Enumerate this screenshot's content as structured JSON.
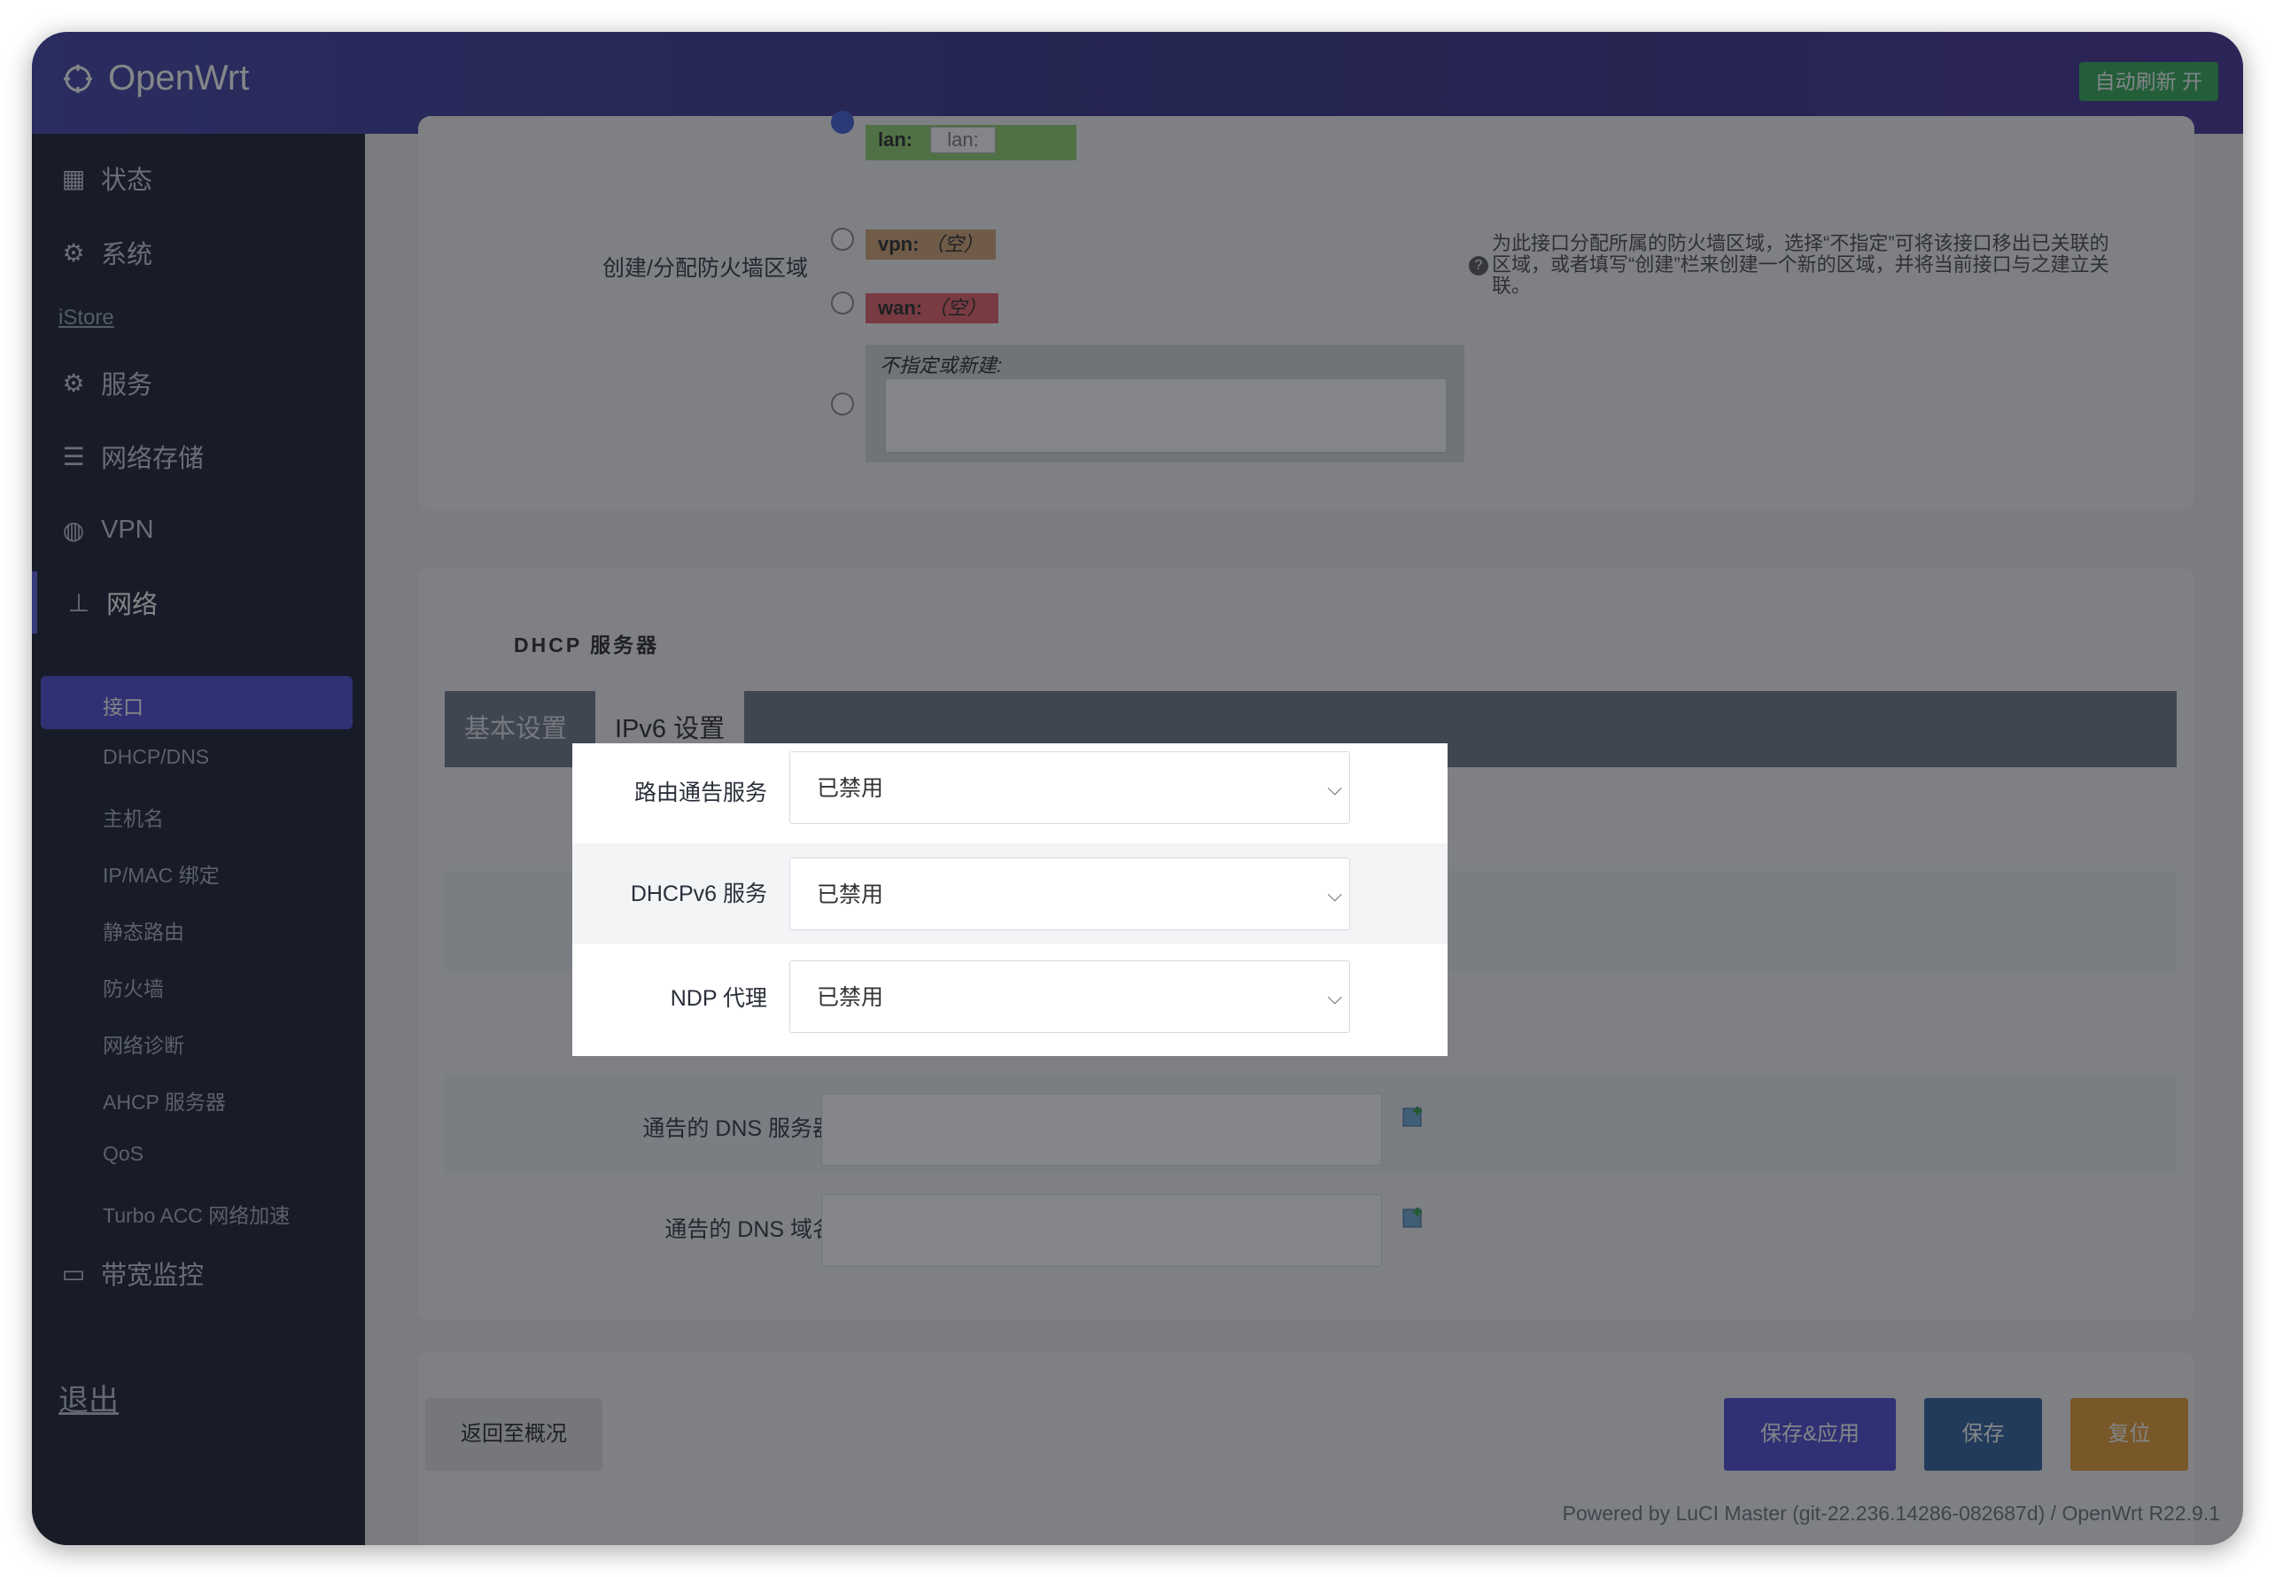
{
  "app": {
    "title": "OpenWrt",
    "autorefresh": "自动刷新 开"
  },
  "sidebar": {
    "items": [
      {
        "label": "状态",
        "icon": "dashboard-icon"
      },
      {
        "label": "系统",
        "icon": "gear-icon"
      },
      {
        "label": "服务",
        "icon": "gears-icon"
      },
      {
        "label": "网络存储",
        "icon": "database-icon"
      },
      {
        "label": "VPN",
        "icon": "globe-icon"
      },
      {
        "label": "网络",
        "icon": "sitemap-icon"
      },
      {
        "label": "带宽监控",
        "icon": "monitor-icon"
      }
    ],
    "istore": "iStore",
    "network_sub": [
      "接口",
      "DHCP/DNS",
      "主机名",
      "IP/MAC 绑定",
      "静态路由",
      "防火墙",
      "网络诊断",
      "AHCP 服务器",
      "QoS",
      "Turbo ACC 网络加速"
    ],
    "logout": "退出"
  },
  "firewall": {
    "label": "创建/分配防火墙区域",
    "lan_tag": "lan:",
    "lan_sub": "lan:",
    "vpn_tag": "vpn:",
    "wan_tag": "wan:",
    "empty": "（空）",
    "custom_label": "不指定或新建:",
    "help": [
      "为此接口分配所属的防火墙区域，选择“不指定”可将该接口移出已关联的",
      "区域，或者填写“创建”栏来创建一个新的区域，并将当前接口与之建立关",
      "联。"
    ]
  },
  "dhcp": {
    "section_title": "DHCP 服务器",
    "tabs": [
      "基本设置",
      "IPv6 设置"
    ],
    "fields": [
      {
        "label": "路由通告服务",
        "value": "已禁用"
      },
      {
        "label": "DHCPv6 服务",
        "value": "已禁用"
      },
      {
        "label": "NDP 代理",
        "value": "已禁用"
      }
    ],
    "dns_server_label": "通告的 DNS 服务器",
    "dns_domain_label": "通告的 DNS 域名"
  },
  "actions": {
    "back": "返回至概况",
    "save_apply": "保存&应用",
    "save": "保存",
    "reset": "复位"
  },
  "footer": "Powered by LuCI Master (git-22.236.14286-082687d) / OpenWrt R22.9.1",
  "colors": {
    "header": "#3b3ca6",
    "sidebar": "#12172d",
    "active": "#4746d3",
    "save_apply": "#4746d3",
    "save": "#2a5b9c",
    "reset": "#e79a2b",
    "autorefresh": "#2aa850"
  }
}
